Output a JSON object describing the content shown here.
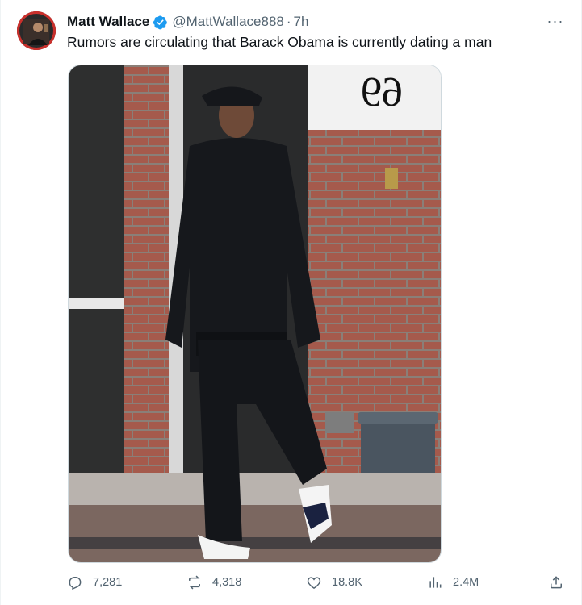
{
  "tweet": {
    "author_name": "Matt Wallace",
    "handle": "@MattWallace888",
    "separator": "·",
    "time": "7h",
    "text": "Rumors are circulating that Barack Obama is currently dating a man",
    "more_label": "···",
    "verified": true
  },
  "media": {
    "sign_text": "69"
  },
  "metrics": {
    "replies": "7,281",
    "reposts": "4,318",
    "likes": "18.8K",
    "views": "2.4M"
  },
  "colors": {
    "text_primary": "#0f1419",
    "text_secondary": "#536471",
    "verified_blue": "#1d9bf0",
    "border": "#cfd9de"
  },
  "icons": {
    "reply": "reply-icon",
    "repost": "repost-icon",
    "like": "heart-icon",
    "views": "views-icon",
    "share": "share-icon",
    "more": "more-icon"
  }
}
